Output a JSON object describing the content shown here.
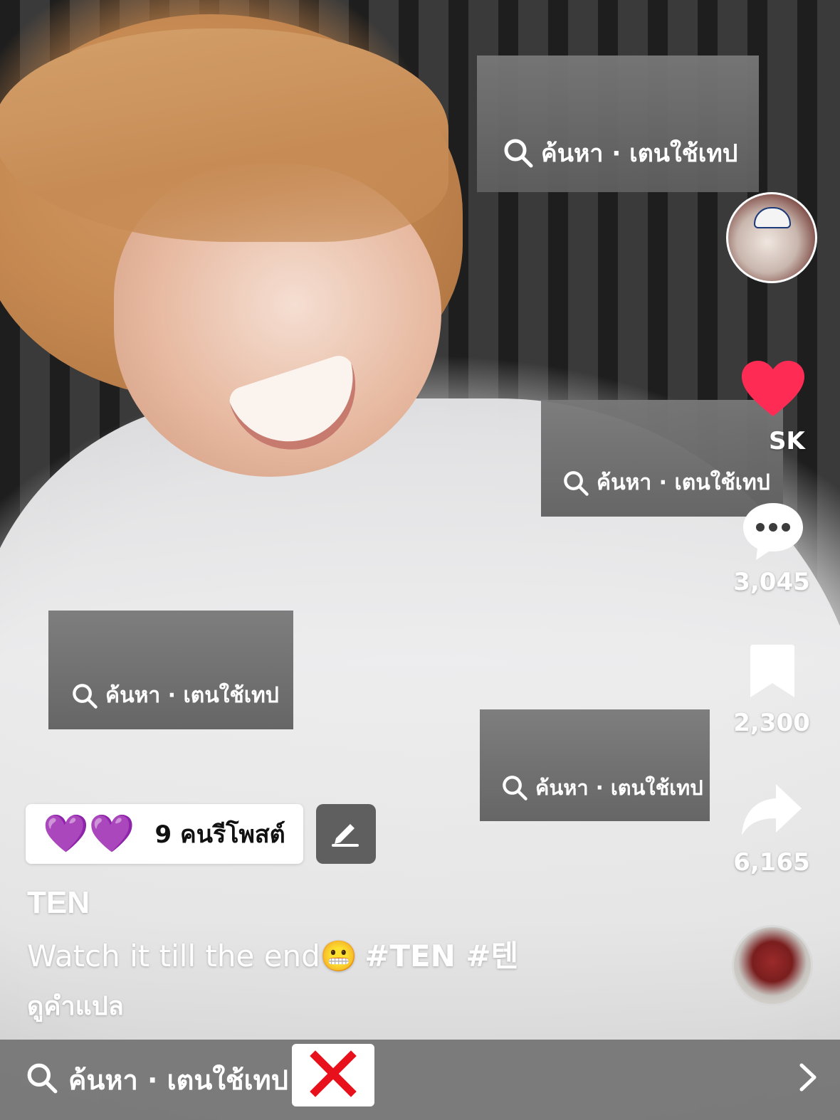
{
  "search_overlays": [
    {
      "text": "ค้นหา · เตนใช้เทป"
    },
    {
      "text": "ค้นหา · เตนใช้เทป"
    },
    {
      "text": "ค้นหา · เตนใช้เทป"
    },
    {
      "text": "ค้นหา · เตนใช้เทป"
    }
  ],
  "rail": {
    "like_count": "SK",
    "comment_count": "3,045",
    "bookmark_count": "2,300",
    "share_count": "6,165"
  },
  "repost": {
    "emoji": "💜💜",
    "label": "9 คนรีโพสต์"
  },
  "post": {
    "author": "TEN",
    "caption": "Watch it till the end😬",
    "hashtags": "#TEN #텐",
    "translate_label": "ดูคำแปล"
  },
  "bottom_bar": {
    "search_text": "ค้นหา · เตนใช้เทป"
  },
  "colors": {
    "like": "#fe2c55",
    "close_x": "#e8101a",
    "bottom_bar": "#737373"
  },
  "icons": [
    "search-icon",
    "heart-icon",
    "comment-icon",
    "bookmark-icon",
    "share-icon",
    "edit-icon",
    "close-icon",
    "chevron-right-icon"
  ]
}
